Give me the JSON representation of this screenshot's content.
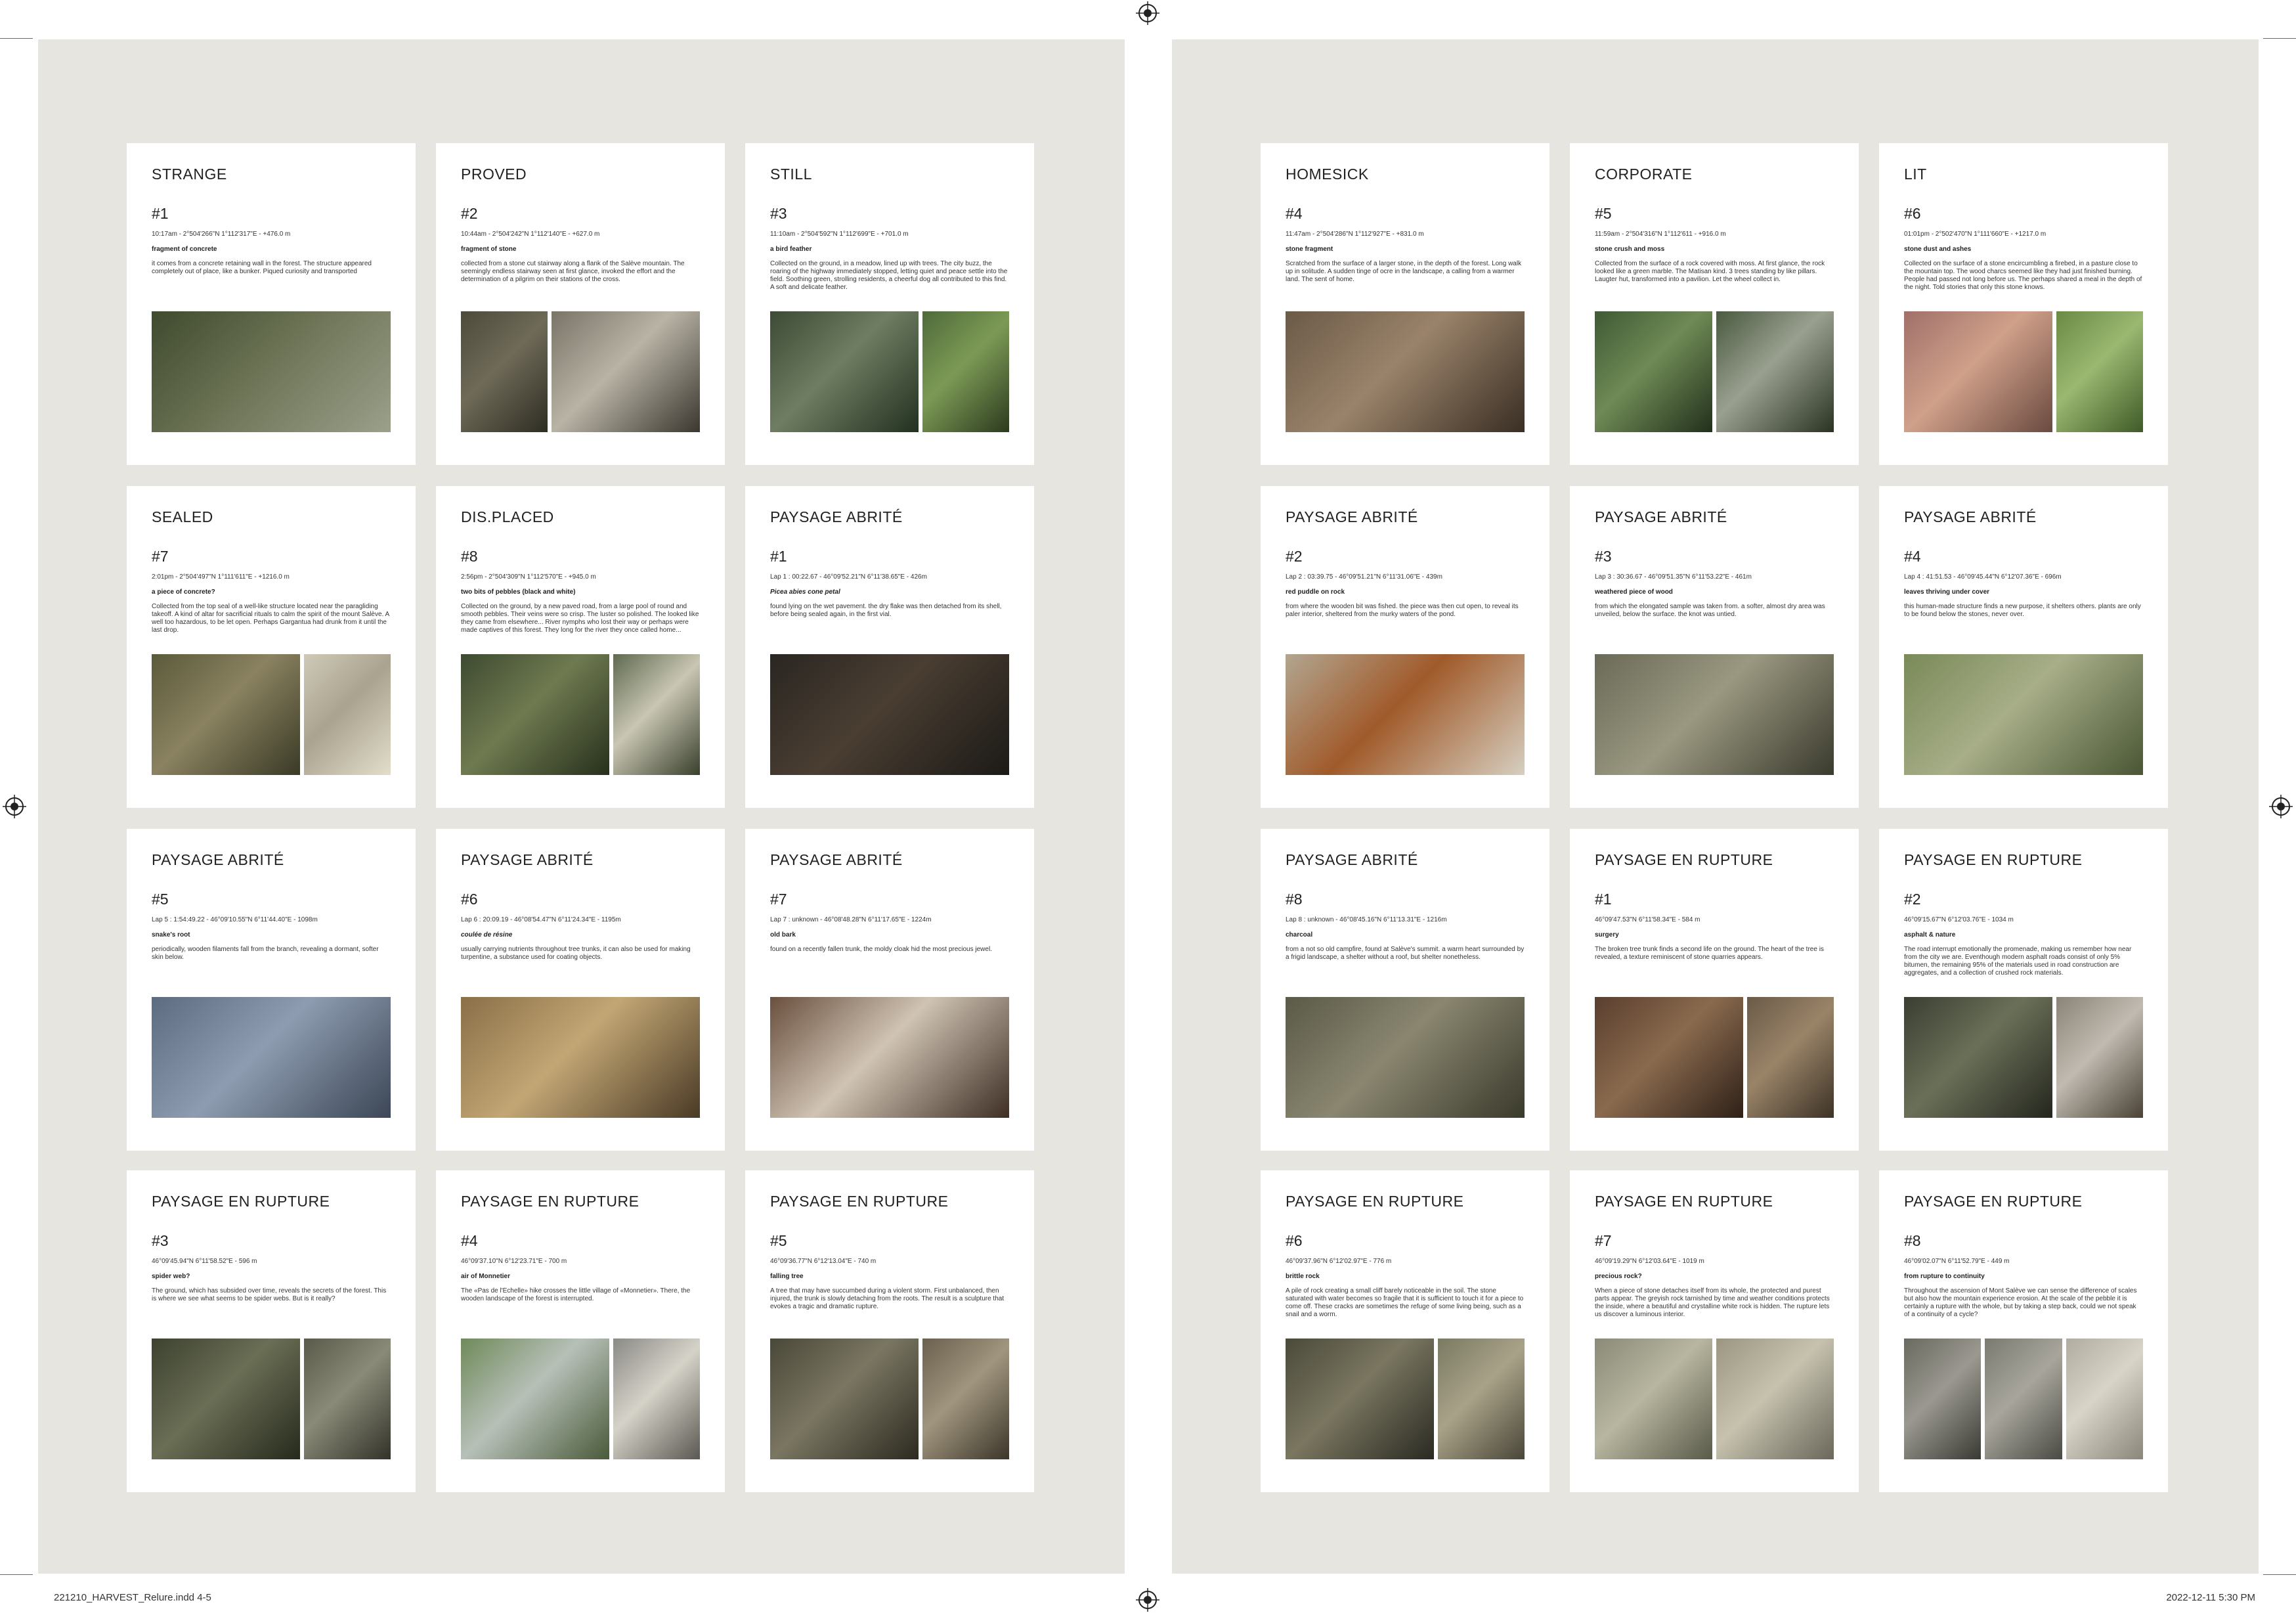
{
  "footer": {
    "file": "221210_HARVEST_Relure.indd   4-5",
    "timestamp": "2022-12-11   5:30 PM"
  },
  "left_cards": [
    {
      "title": "STRANGE",
      "num": "#1",
      "coords": "10:17am - 2°504'266\"N 1°112'317\"E - +476.0 m",
      "subtitle": "fragment of concrete",
      "italic": false,
      "desc": "it comes from a concrete retaining wall in the forest. The structure appeared completely out of place, like a bunker. Piqued curiosity and transported",
      "photos": [
        {
          "w": "w-full",
          "colors": [
            "#3f4a2e",
            "#6b7254",
            "#9aa08a",
            "#2f3623"
          ]
        }
      ]
    },
    {
      "title": "PROVED",
      "num": "#2",
      "coords": "10:44am - 2°504'242\"N 1°112'140\"E - +627.0 m",
      "subtitle": "fragment of stone",
      "italic": false,
      "desc": "collected from a stone cut stairway along a flank of the Salève mountain. The seemingly endless stairway seen at first glance, invoked the effort and the determination of a pilgrim on their stations of the cross.",
      "photos": [
        {
          "w": "w-narrow",
          "colors": [
            "#4c4a3a",
            "#6f6a58",
            "#2e2d22"
          ]
        },
        {
          "w": "w-wide",
          "colors": [
            "#7a7468",
            "#b9b3a6",
            "#3b372f"
          ]
        }
      ]
    },
    {
      "title": "STILL",
      "num": "#3",
      "coords": "11:10am - 2°504'592\"N 1°112'699\"E - +701.0 m",
      "subtitle": "a bird feather",
      "italic": false,
      "desc": "Collected on the ground, in a meadow, lined up with trees. The city buzz, the roaring of the highway immediately stopped, letting quiet and peace settle into the field. Soothing green, strolling residents, a cheerful dog all contributed to this find. A soft and delicate feather.",
      "photos": [
        {
          "w": "w-wide",
          "colors": [
            "#3d4a35",
            "#6f7d62",
            "#223020"
          ]
        },
        {
          "w": "w-narrow",
          "colors": [
            "#4f6a3a",
            "#7c9a55",
            "#2c3a1e"
          ]
        }
      ]
    },
    {
      "title": "SEALED",
      "num": "#7",
      "coords": "2:01pm - 2°504'497\"N 1°111'611\"E - +1216.0 m",
      "subtitle": "a piece of concrete?",
      "italic": false,
      "desc": "Collected from the top seal of a well-like structure located near the paragliding takeoff. A kind of altar for sacrificial rituals to calm the spirit of the mount Salève. A well too hazardous, to be let open. Perhaps Gargantua had drunk from it until the last drop.",
      "photos": [
        {
          "w": "w-wide",
          "colors": [
            "#5a5a3a",
            "#8a8260",
            "#3a3a26"
          ]
        },
        {
          "w": "w-narrow",
          "colors": [
            "#cfc9b8",
            "#a9a38f",
            "#e3ddcc"
          ]
        }
      ]
    },
    {
      "title": "DIS.PLACED",
      "num": "#8",
      "coords": "2:56pm - 2°504'309\"N 1°112'570\"E - +945.0 m",
      "subtitle": "two bits of pebbles (black and white)",
      "italic": false,
      "desc": "Collected on the ground, by a new paved road, from a large pool of round and smooth pebbles. Their veins were so crisp. The luster so polished. The looked like they came from elsewhere... River nymphs who lost their way or perhaps were made captives of this forest. They long for the river they once called home...",
      "photos": [
        {
          "w": "w-wide",
          "colors": [
            "#3d4a30",
            "#6f7a50",
            "#27301c"
          ]
        },
        {
          "w": "w-narrow",
          "colors": [
            "#5f6a50",
            "#c9c6b3",
            "#38402c"
          ]
        }
      ]
    },
    {
      "title": "PAYSAGE ABRITÉ",
      "num": "#1",
      "coords": "Lap 1 : 00:22.67 - 46°09'52.21\"N 6°11'38.65\"E - 426m",
      "subtitle": "Picea abies cone petal",
      "italic": true,
      "desc": "found lying on the wet pavement. the dry flake was then detached from its shell, before being sealed again, in the first vial.",
      "photos": [
        {
          "w": "w-full",
          "colors": [
            "#2a2622",
            "#4a3e32",
            "#1c1a17"
          ]
        }
      ]
    },
    {
      "title": "PAYSAGE ABRITÉ",
      "num": "#5",
      "coords": "Lap 5 : 1:54:49.22 - 46°09'10.55\"N 6°11'44.40\"E - 1098m",
      "subtitle": "snake's root",
      "italic": false,
      "desc": "periodically, wooden filaments fall from the branch, revealing a dormant, softer skin below.",
      "photos": [
        {
          "w": "w-full",
          "colors": [
            "#5c6b80",
            "#8d9cb0",
            "#3c4656"
          ]
        }
      ]
    },
    {
      "title": "PAYSAGE ABRITÉ",
      "num": "#6",
      "coords": "Lap 6 : 20:09.19 - 46°08'54.47\"N 6°11'24.34\"E - 1195m",
      "subtitle": "coulée de résine",
      "italic": true,
      "desc": "usually carrying nutrients throughout tree trunks, it can also be used for making turpentine, a substance used for coating objects.",
      "photos": [
        {
          "w": "w-full",
          "colors": [
            "#8a6f48",
            "#c2a674",
            "#4a3a26"
          ]
        }
      ]
    },
    {
      "title": "PAYSAGE ABRITÉ",
      "num": "#7",
      "coords": "Lap 7 : unknown - 46°08'48.28\"N 6°11'17.65\"E - 1224m",
      "subtitle": "old bark",
      "italic": false,
      "desc": "found on a recently fallen trunk, the moldy cloak hid the most precious jewel.",
      "photos": [
        {
          "w": "w-full",
          "colors": [
            "#6a4f3e",
            "#cfc3b3",
            "#3e2e24"
          ]
        }
      ]
    },
    {
      "title": "PAYSAGE EN RUPTURE",
      "num": "#3",
      "coords": "46°09'45.94\"N 6°11'58.52\"E - 596 m",
      "subtitle": "spider web?",
      "italic": false,
      "desc": "The ground, which has subsided over time, reveals the secrets of the forest. This is where we see what seems to be spider webs. But is it really?",
      "photos": [
        {
          "w": "w-wide",
          "colors": [
            "#3d4230",
            "#6a6e55",
            "#262a1c"
          ]
        },
        {
          "w": "w-narrow",
          "colors": [
            "#5a5a4a",
            "#8a8a78",
            "#33332a"
          ]
        }
      ]
    },
    {
      "title": "PAYSAGE EN RUPTURE",
      "num": "#4",
      "coords": "46°09'37.10\"N 6°12'23.71\"E - 700 m",
      "subtitle": "air of Monnetier",
      "italic": false,
      "desc": "The «Pas de l'Échelle» hike crosses the little village of «Monnetier». There, the wooden landscape of the forest is interrupted.",
      "photos": [
        {
          "w": "w-wide",
          "colors": [
            "#6f8a5a",
            "#b7c0b8",
            "#4a5a3a"
          ]
        },
        {
          "w": "w-narrow",
          "colors": [
            "#8a8a86",
            "#d5d2c8",
            "#5a5852"
          ]
        }
      ]
    },
    {
      "title": "PAYSAGE EN RUPTURE",
      "num": "#5",
      "coords": "46°09'36.77\"N 6°12'13.04\"E - 740 m",
      "subtitle": "falling tree",
      "italic": false,
      "desc": "A tree that may have succumbed during a violent storm. First unbalanced, then injured, the trunk is slowly detaching from the roots. The result is a sculpture that evokes a tragic and dramatic rupture.",
      "photos": [
        {
          "w": "w-wide",
          "colors": [
            "#4a4838",
            "#7a7662",
            "#2c2a20"
          ]
        },
        {
          "w": "w-narrow",
          "colors": [
            "#6a604e",
            "#a0957e",
            "#3c362a"
          ]
        }
      ]
    }
  ],
  "right_cards": [
    {
      "title": "HOMESICK",
      "num": "#4",
      "coords": "11:47am - 2°504'286\"N 1°112'927\"E - +831.0 m",
      "subtitle": "stone fragment",
      "italic": false,
      "desc": "Scratched from the surface of a larger stone, in the depth of the forest. Long walk up in solitude. A sudden tinge of ocre in the landscape, a calling from a warmer land. The sent of home.",
      "photos": [
        {
          "w": "w-full",
          "colors": [
            "#6b5a48",
            "#9a836a",
            "#3a2e24"
          ]
        }
      ]
    },
    {
      "title": "CORPORATE",
      "num": "#5",
      "coords": "11:59am - 2°504'316\"N 1°112'611 - +916.0 m",
      "subtitle": "stone crush and moss",
      "italic": false,
      "desc": "Collected from the surface of a rock covered with moss. At first glance, the rock looked like a green marble. The Matisan kind. 3 trees standing by like pillars. Laugter hut, transformed into a pavilion. Let the wheel collect in.",
      "photos": [
        {
          "w": "w-half",
          "colors": [
            "#3f5a35",
            "#6f8a55",
            "#22301c"
          ]
        },
        {
          "w": "w-half",
          "colors": [
            "#4a5a40",
            "#9aa090",
            "#2a3322"
          ]
        }
      ]
    },
    {
      "title": "LIT",
      "num": "#6",
      "coords": "01:01pm - 2°502'470\"N 1°111'660\"E - +1217.0 m",
      "subtitle": "stone dust and ashes",
      "italic": false,
      "desc": "Collected on the surface of a stone encircumbling a firebed, in a pasture close to the mountain top. The wood charcs seemed like they had just finished burning. People had passed not long before us. The perhaps shared a meal in the depth of the night. Told stories that only this stone knows.",
      "photos": [
        {
          "w": "w-wide",
          "colors": [
            "#a0706a",
            "#d0a08a",
            "#6a4a40"
          ]
        },
        {
          "w": "w-narrow",
          "colors": [
            "#6a8a45",
            "#9ab870",
            "#3f5a28"
          ]
        }
      ]
    },
    {
      "title": "PAYSAGE ABRITÉ",
      "num": "#2",
      "coords": "Lap 2 : 03:39.75 - 46°09'51.21\"N 6°11'31.06\"E - 439m",
      "subtitle": "red puddle on rock",
      "italic": false,
      "desc": "from where the wooden bit was fished. the piece was then cut open, to reveal its paler interior, sheltered from the murky waters of the pond.",
      "photos": [
        {
          "w": "w-full",
          "colors": [
            "#b2a690",
            "#a05a2a",
            "#d6cfc0"
          ]
        }
      ]
    },
    {
      "title": "PAYSAGE ABRITÉ",
      "num": "#3",
      "coords": "Lap 3 : 30:36.67 - 46°09'51.35\"N 6°11'53.22\"E - 461m",
      "subtitle": "weathered piece of wood",
      "italic": false,
      "desc": "from which the elongated sample was taken from. a softer, almost dry area was unveiled, below the surface. the knot was untied.",
      "photos": [
        {
          "w": "w-full",
          "colors": [
            "#6a6a58",
            "#9a9880",
            "#3a3a2e"
          ]
        }
      ]
    },
    {
      "title": "PAYSAGE ABRITÉ",
      "num": "#4",
      "coords": "Lap 4 : 41:51.53 - 46°09'45.44\"N 6°12'07.36\"E - 696m",
      "subtitle": "leaves thriving under cover",
      "italic": false,
      "desc": "this human-made structure finds a new purpose, it shelters others. plants are only to be found below the stones, never over.",
      "photos": [
        {
          "w": "w-full",
          "colors": [
            "#7a8a58",
            "#a7ae88",
            "#4a5634"
          ]
        }
      ]
    },
    {
      "title": "PAYSAGE ABRITÉ",
      "num": "#8",
      "coords": "Lap 8 : unknown - 46°08'45.16\"N 6°11'13.31\"E - 1216m",
      "subtitle": "charcoal",
      "italic": false,
      "desc": "from a not so old campfire, found at Salève's summit. a warm heart surrounded by a frigid landscape, a shelter without a roof, but shelter nonetheless.",
      "photos": [
        {
          "w": "w-full",
          "colors": [
            "#5a5a48",
            "#8a8670",
            "#3a3a2c"
          ]
        }
      ]
    },
    {
      "title": "PAYSAGE EN RUPTURE",
      "num": "#1",
      "coords": "46°09'47.53\"N 6°11'58.34\"E - 584 m",
      "subtitle": "surgery",
      "italic": false,
      "desc": "The broken tree trunk finds a second life on the ground. The heart of the tree is revealed, a texture reminiscent of stone quarries appears.",
      "photos": [
        {
          "w": "w-wide",
          "colors": [
            "#5a3e2e",
            "#8a6a4e",
            "#2e2018"
          ]
        },
        {
          "w": "w-narrow",
          "colors": [
            "#6a5a48",
            "#9a8468",
            "#3c3226"
          ]
        }
      ]
    },
    {
      "title": "PAYSAGE EN RUPTURE",
      "num": "#2",
      "coords": "46°09'15.67\"N 6°12'03.76\"E - 1034 m",
      "subtitle": "asphalt & nature",
      "italic": false,
      "desc": "The road interrupt emotionally the promenade, making us remember how near from the city we are. Eventhough modern asphalt roads consist of only 5% bitumen, the remaining 95% of the materials used in road construction are aggregates, and a collection of crushed rock materials.",
      "photos": [
        {
          "w": "w-wide",
          "colors": [
            "#3a3e32",
            "#6a7058",
            "#24261e"
          ]
        },
        {
          "w": "w-narrow",
          "colors": [
            "#8a8478",
            "#c0bab0",
            "#4a4236"
          ]
        }
      ]
    },
    {
      "title": "PAYSAGE EN RUPTURE",
      "num": "#6",
      "coords": "46°09'37.96\"N 6°12'02.97\"E - 776 m",
      "subtitle": "brittle rock",
      "italic": false,
      "desc": "A pile of rock creating a small cliff barely noticeable in the soil. The stone saturated with water becomes so fragile that it is sufficient to touch it for a piece to come off. These cracks are sometimes the refuge of some living being, such as a snail and a worm.",
      "photos": [
        {
          "w": "w-wide",
          "colors": [
            "#4a4a3a",
            "#7a7660",
            "#2a2a22"
          ]
        },
        {
          "w": "w-narrow",
          "colors": [
            "#7a7a62",
            "#a8a288",
            "#4a4638"
          ]
        }
      ]
    },
    {
      "title": "PAYSAGE EN RUPTURE",
      "num": "#7",
      "coords": "46°09'19.29\"N 6°12'03.64\"E - 1019 m",
      "subtitle": "precious rock?",
      "italic": false,
      "desc": "When a piece of stone detaches itself from its whole, the protected and purest parts appear. The greyish rock tarnished by time and weather conditions protects the inside, where a beautiful and crystalline white rock is hidden. The rupture lets us discover a luminous interior.",
      "photos": [
        {
          "w": "w-half",
          "colors": [
            "#8a8a78",
            "#b8b6a0",
            "#5a5a4a"
          ]
        },
        {
          "w": "w-half",
          "colors": [
            "#9a9682",
            "#c6c2ae",
            "#6a665a"
          ]
        }
      ]
    },
    {
      "title": "PAYSAGE EN RUPTURE",
      "num": "#8",
      "coords": "46°09'02.07\"N 6°11'52.79\"E - 449 m",
      "subtitle": "from rupture to continuity",
      "italic": false,
      "desc": "Throughout the ascension of Mont Salève we can sense the difference of scales but also how the mountain experience erosion. At the scale of the pebble it is certainly a rupture with the whole, but by taking a step back, could we not speak of a continuity of a cycle?",
      "photos": [
        {
          "w": "w-third",
          "colors": [
            "#6a6a60",
            "#9a9890",
            "#3a3a34"
          ]
        },
        {
          "w": "w-third",
          "colors": [
            "#7a7a70",
            "#a8a69c",
            "#4a4a44"
          ]
        },
        {
          "w": "w-third",
          "colors": [
            "#b0aca0",
            "#d8d4c8",
            "#8a867a"
          ]
        }
      ]
    }
  ]
}
